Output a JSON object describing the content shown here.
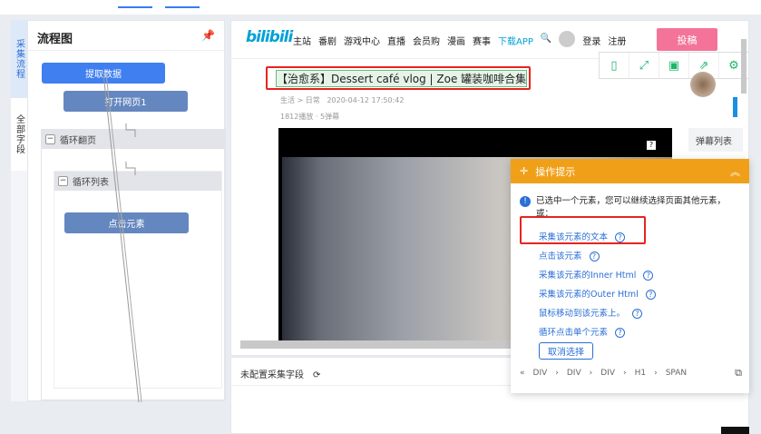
{
  "left_tabs": [
    "采集流程",
    "全部字段"
  ],
  "flow": {
    "title": "流程图",
    "nodes": {
      "extract": "提取数据",
      "open": "打开网页1",
      "click": "点击元素"
    },
    "groups": {
      "page_loop": "循环翻页",
      "list_loop": "循环列表"
    }
  },
  "site": {
    "logo": "bilibili",
    "nav": [
      "主站",
      "番剧",
      "游戏中心",
      "直播",
      "会员购",
      "漫画",
      "赛事",
      "下载APP"
    ],
    "login": "登录",
    "register": "注册",
    "upload": "投稿",
    "video_title": "【治愈系】Dessert café vlog | Zoe 罐装咖啡合集",
    "category": "生活 > 日常",
    "date": "2020-04-12 17:50:42",
    "stats": "1812播放 · 5弹幕",
    "danmaku_list": "弹幕列表"
  },
  "fields": {
    "empty": "未配置采集字段"
  },
  "popup": {
    "title": "操作提示",
    "message": "已选中一个元素，您可以继续选择页面其他元素，或：",
    "actions": [
      "采集该元素的文本",
      "点击该元素",
      "采集该元素的Inner Html",
      "采集该元素的Outer Html",
      "鼠标移动到该元素上。",
      "循环点击单个元素"
    ],
    "cancel": "取消选择",
    "breadcrumb": [
      "DIV",
      "DIV",
      "DIV",
      "H1",
      "SPAN"
    ]
  },
  "colors": {
    "accent": "#3f7ff0",
    "warning": "#f0a018",
    "highlight": "#e8231f",
    "pink": "#f47499"
  }
}
